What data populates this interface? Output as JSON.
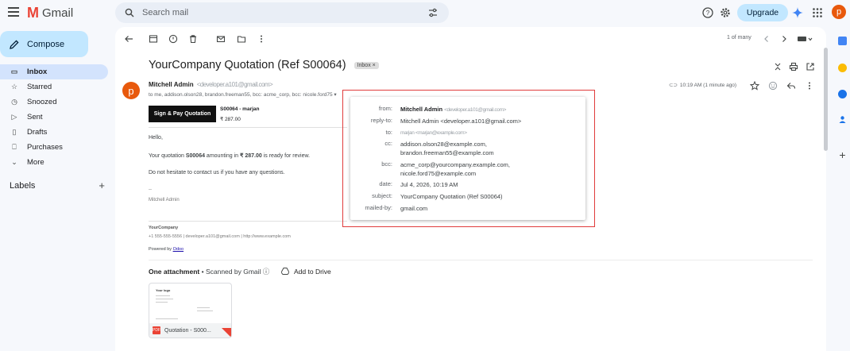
{
  "app": {
    "name": "Gmail",
    "logo_letter": "M"
  },
  "search": {
    "placeholder": "Search mail"
  },
  "header": {
    "upgrade_label": "Upgrade",
    "avatar_letter": "p"
  },
  "sidebar": {
    "compose_label": "Compose",
    "items": [
      {
        "label": "Inbox",
        "icon": "inbox-icon",
        "glyph": "▭",
        "active": true
      },
      {
        "label": "Starred",
        "icon": "star-icon",
        "glyph": "☆"
      },
      {
        "label": "Snoozed",
        "icon": "clock-icon",
        "glyph": "◷"
      },
      {
        "label": "Sent",
        "icon": "send-icon",
        "glyph": "▷"
      },
      {
        "label": "Drafts",
        "icon": "draft-icon",
        "glyph": "▯"
      },
      {
        "label": "Purchases",
        "icon": "bag-icon",
        "glyph": "⎕"
      },
      {
        "label": "More",
        "icon": "chevron-down-icon",
        "glyph": "⌄"
      }
    ],
    "labels_title": "Labels",
    "labels_add": "+"
  },
  "toolbar": {
    "pager": "1 of many"
  },
  "email": {
    "subject": "YourCompany Quotation (Ref S00064)",
    "tag": "Inbox ×",
    "avatar_letter": "p",
    "sender_name": "Mitchell Admin",
    "sender_address": "<developer.a101@gmail.com>",
    "recipients": "to me, addison.olson28, brandon.freeman55, bcc: acme_corp, bcc: nicole.ford75 ▾",
    "time": "10:19 AM (1 minute ago)",
    "button_label": "Sign & Pay Quotation",
    "quote_number": "S00064 - marjan",
    "quote_amount": "₹ 287.00",
    "greeting": "Hello,",
    "para1_prefix": "Your quotation ",
    "para1_ref": "S00064",
    "para1_mid": " amounting in ",
    "para1_amount": "₹ 287.00",
    "para1_suffix": " is ready for review.",
    "para2": "Do not hesitate to contact us if you have any questions.",
    "dashes": "--",
    "signature": "Mitchell Admin",
    "company": "YourCompany",
    "company_contact": "+1 555-555-5556 | developer.a101@gmail.com | http://www.example.com",
    "powered_prefix": "Powered by ",
    "powered_link": "Odoo"
  },
  "attachment": {
    "heading": "One attachment",
    "scanned": " • Scanned by Gmail ⓘ",
    "add_to_drive": "Add to Drive",
    "filename": "Quotation - S000...",
    "thumb_logo": "Your logo"
  },
  "details": {
    "from_label": "from:",
    "from_name": "Mitchell Admin",
    "from_addr": "<developer.a101@gmail.com>",
    "replyto_label": "reply-to:",
    "replyto": "Mitchell Admin <developer.a101@gmail.com>",
    "to_label": "to:",
    "to": "marjan <marjan@example.com>",
    "cc_label": "cc:",
    "cc1": "addison.olson28@example.com,",
    "cc2": "brandon.freeman55@example.com",
    "bcc_label": "bcc:",
    "bcc1": "acme_corp@yourcompany.example.com,",
    "bcc2": "nicole.ford75@example.com",
    "date_label": "date:",
    "date": "Jul 4, 2026, 10:19 AM",
    "subject_label": "subject:",
    "subject": "YourCompany Quotation (Ref S00064)",
    "mailedby_label": "mailed-by:",
    "mailedby": "gmail.com"
  },
  "colors": {
    "accent": "#c2e7ff",
    "highlight": "#e03b3b",
    "avatar": "#e8590c"
  }
}
